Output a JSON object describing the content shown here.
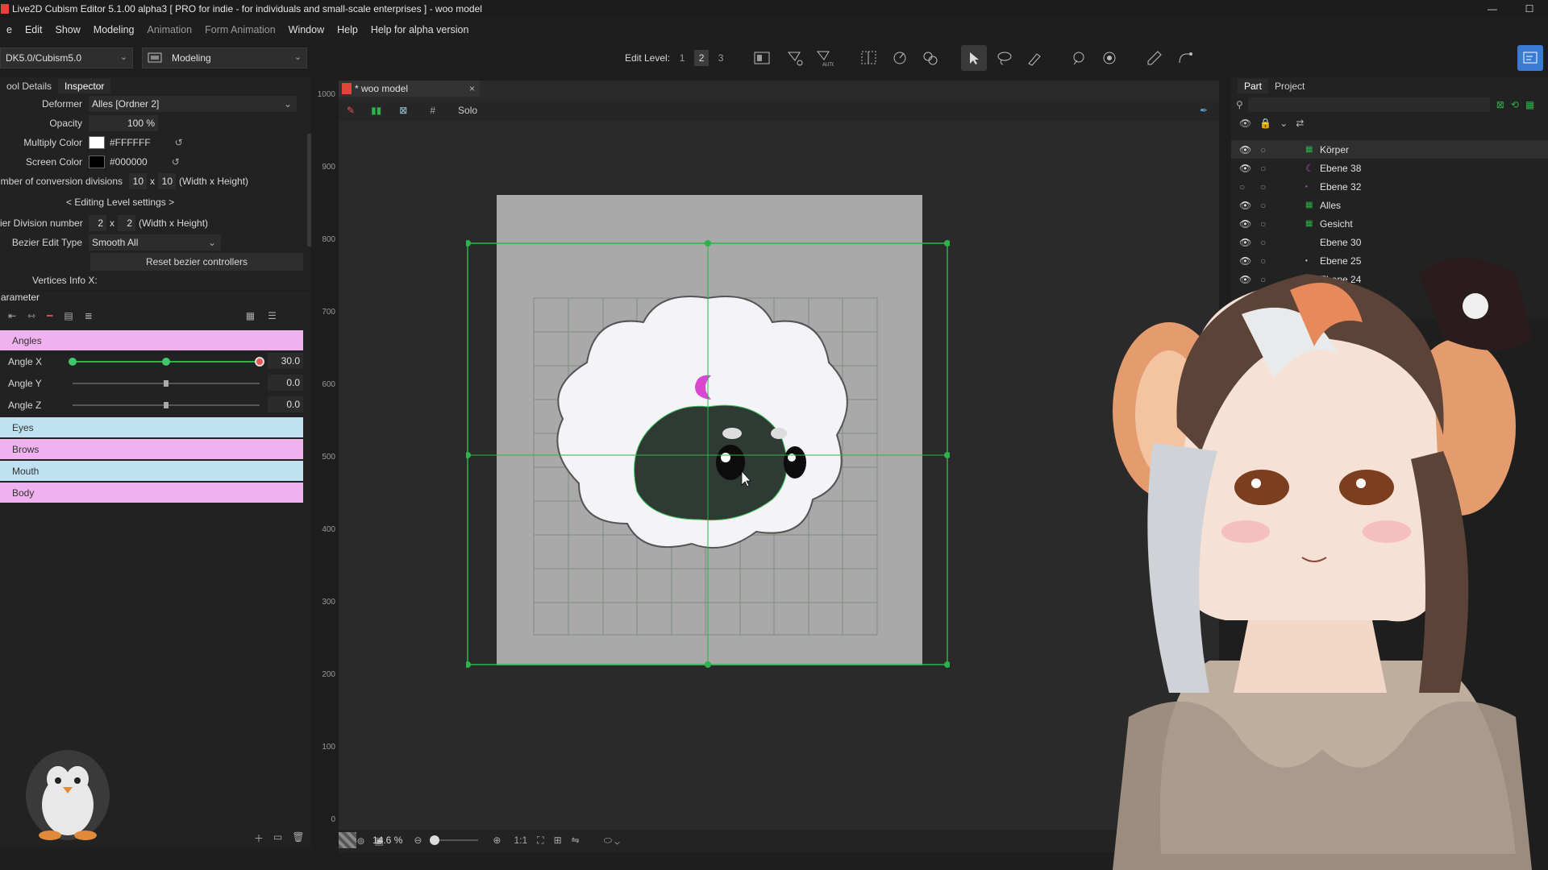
{
  "titlebar": {
    "title": "Live2D Cubism Editor 5.1.00 alpha3   [ PRO for indie - for individuals and small-scale enterprises ]  - woo model"
  },
  "menu": [
    "e",
    "Edit",
    "Show",
    "Modeling",
    "Animation",
    "Form Animation",
    "Window",
    "Help",
    "Help for alpha version"
  ],
  "toolbar": {
    "workspace_path": "DK5.0/Cubism5.0",
    "mode": "Modeling",
    "edit_level_label": "Edit Level:",
    "levels": [
      "1",
      "2",
      "3"
    ],
    "active_level": "2"
  },
  "left_panel": {
    "tabs": [
      "ool Details",
      "Inspector"
    ],
    "rows": {
      "deformer_label": "Deformer",
      "deformer_value": "Alles  [Ordner 2]",
      "opacity_label": "Opacity",
      "opacity_value": "100 %",
      "multiply_label": "Multiply Color",
      "multiply_value": "#FFFFFF",
      "screen_label": "Screen Color",
      "screen_value": "#000000",
      "conv_label": "mber of conversion divisions",
      "conv_w": "10",
      "conv_x": "x",
      "conv_h": "10",
      "conv_suffix": "(Width x Height)",
      "editing_header": "< Editing Level settings >",
      "bezier_div_label": "ier Division number",
      "bezier_w": "2",
      "bezier_x": "x",
      "bezier_h": "2",
      "bezier_suffix": "(Width x Height)",
      "bezier_type_label": "Bezier Edit Type",
      "bezier_type_value": "Smooth All",
      "reset_button": "Reset bezier controllers",
      "vertices_info": "Vertices Info  X:"
    }
  },
  "parameter_panel": {
    "title": "arameter",
    "groups": {
      "angles": "Angles",
      "eyes": "Eyes",
      "brows": "Brows",
      "mouth": "Mouth",
      "body": "Body"
    },
    "params": [
      {
        "name": "Angle X",
        "value": "30.0",
        "level": 1.0
      },
      {
        "name": "Angle Y",
        "value": "0.0",
        "level": 0.5
      },
      {
        "name": "Angle Z",
        "value": "0.0",
        "level": 0.5
      }
    ]
  },
  "viewport": {
    "tab_label": "* woo model",
    "solo_label": "Solo",
    "ruler": [
      "1000",
      "900",
      "800",
      "700",
      "600",
      "500",
      "400",
      "300",
      "200",
      "100",
      "0"
    ],
    "zoom": "14.6 %",
    "ratio_label": "1:1"
  },
  "right_panel": {
    "tabs": [
      "Part",
      "Project"
    ],
    "parts": [
      "Körper",
      "Ebene 38",
      "Ebene 32",
      "Alles",
      "Gesicht",
      "Ebene 30",
      "Ebene 25",
      "Ebene 24"
    ]
  },
  "colors": {
    "pink_group": "#f0b2ee",
    "blue_group": "#bfe1f2",
    "accent_green": "#2cb34a"
  }
}
